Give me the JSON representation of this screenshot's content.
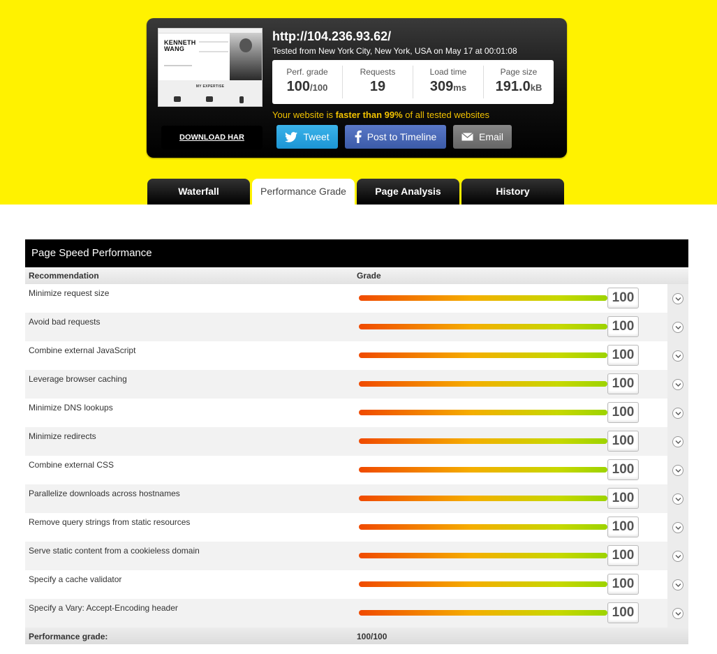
{
  "summary": {
    "thumbnail": {
      "name_line1": "KENNETH",
      "name_line2": "WANG",
      "section": "MY EXPERTISE"
    },
    "url": "http://104.236.93.62/",
    "tested": "Tested from New York City, New York, USA on May 17 at 00:01:08",
    "stats": [
      {
        "label": "Perf. grade",
        "value": "100",
        "unit": "/100"
      },
      {
        "label": "Requests",
        "value": "19",
        "unit": ""
      },
      {
        "label": "Load time",
        "value": "309",
        "unit": "ms"
      },
      {
        "label": "Page size",
        "value": "191.0",
        "unit": "kB"
      }
    ],
    "faster_prefix": "Your website is ",
    "faster_bold": "faster than 99%",
    "faster_suffix": " of all tested websites",
    "download_har": "DOWNLOAD HAR",
    "share": {
      "tweet": "Tweet",
      "facebook": "Post to Timeline",
      "email": "Email"
    }
  },
  "tabs": [
    {
      "label": "Waterfall",
      "active": false
    },
    {
      "label": "Performance Grade",
      "active": true
    },
    {
      "label": "Page Analysis",
      "active": false
    },
    {
      "label": "History",
      "active": false
    }
  ],
  "panel": {
    "title": "Page Speed Performance",
    "col_recommendation": "Recommendation",
    "col_grade": "Grade",
    "rows": [
      {
        "name": "Minimize request size",
        "score": "100",
        "fraction": 1.0
      },
      {
        "name": "Avoid bad requests",
        "score": "100",
        "fraction": 1.0
      },
      {
        "name": "Combine external JavaScript",
        "score": "100",
        "fraction": 1.0
      },
      {
        "name": "Leverage browser caching",
        "score": "100",
        "fraction": 1.0
      },
      {
        "name": "Minimize DNS lookups",
        "score": "100",
        "fraction": 1.0
      },
      {
        "name": "Minimize redirects",
        "score": "100",
        "fraction": 1.0
      },
      {
        "name": "Combine external CSS",
        "score": "100",
        "fraction": 1.0
      },
      {
        "name": "Parallelize downloads across hostnames",
        "score": "100",
        "fraction": 1.0
      },
      {
        "name": "Remove query strings from static resources",
        "score": "100",
        "fraction": 1.0
      },
      {
        "name": "Serve static content from a cookieless domain",
        "score": "100",
        "fraction": 1.0
      },
      {
        "name": "Specify a cache validator",
        "score": "100",
        "fraction": 1.0
      },
      {
        "name": "Specify a Vary: Accept-Encoding header",
        "score": "100",
        "fraction": 1.0
      }
    ],
    "footer_label": "Performance grade:",
    "footer_value": "100/100"
  },
  "colors": {
    "band": "#fff200",
    "highlight": "#f2c200",
    "tweet": "#1c95d4",
    "facebook": "#3b5ba8"
  },
  "icons": [
    "twitter-icon",
    "facebook-icon",
    "email-icon",
    "chevron-down-icon"
  ]
}
